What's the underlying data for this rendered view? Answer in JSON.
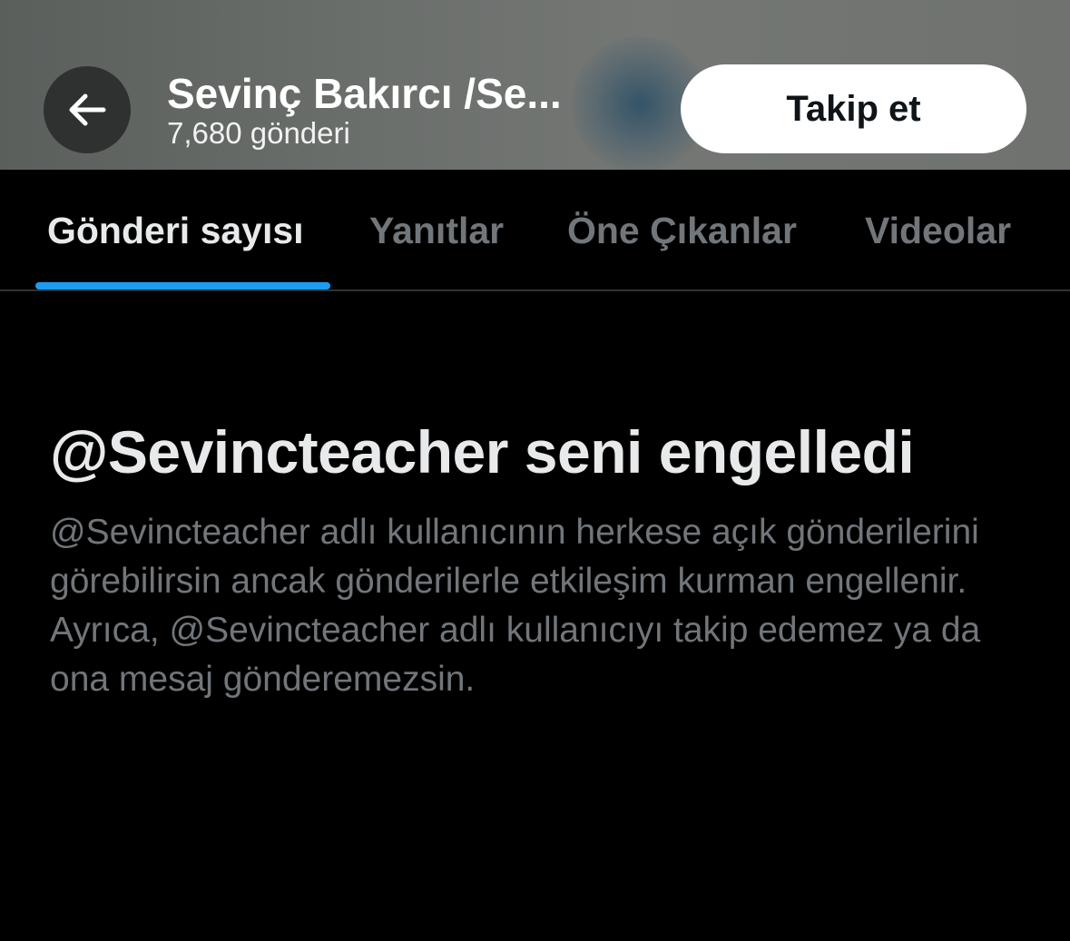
{
  "header": {
    "back_icon": "arrow-left-icon",
    "name": "Sevinç Bakırcı /Se...",
    "post_count": "7,680 gönderi",
    "follow_label": "Takip et"
  },
  "tabs": [
    {
      "label": "Gönderi sayısı",
      "active": true
    },
    {
      "label": "Yanıtlar",
      "active": false
    },
    {
      "label": "Öne Çıkanlar",
      "active": false
    },
    {
      "label": "Videolar",
      "active": false
    }
  ],
  "blocked": {
    "title": "@Sevincteacher seni engelledi",
    "description": "@Sevincteacher adlı kullanıcının herkese açık gönderilerini görebilirsin ancak gönderilerle etkileşim kurman engellenir. Ayrıca, @Sevincteacher adlı kullanıcıyı takip edemez ya da ona mesaj gönderemezsin."
  },
  "colors": {
    "background": "#000000",
    "accent": "#1d9bf0",
    "primary_text": "#e7e9ea",
    "secondary_text": "#71767b",
    "follow_button": "#ffffff"
  }
}
